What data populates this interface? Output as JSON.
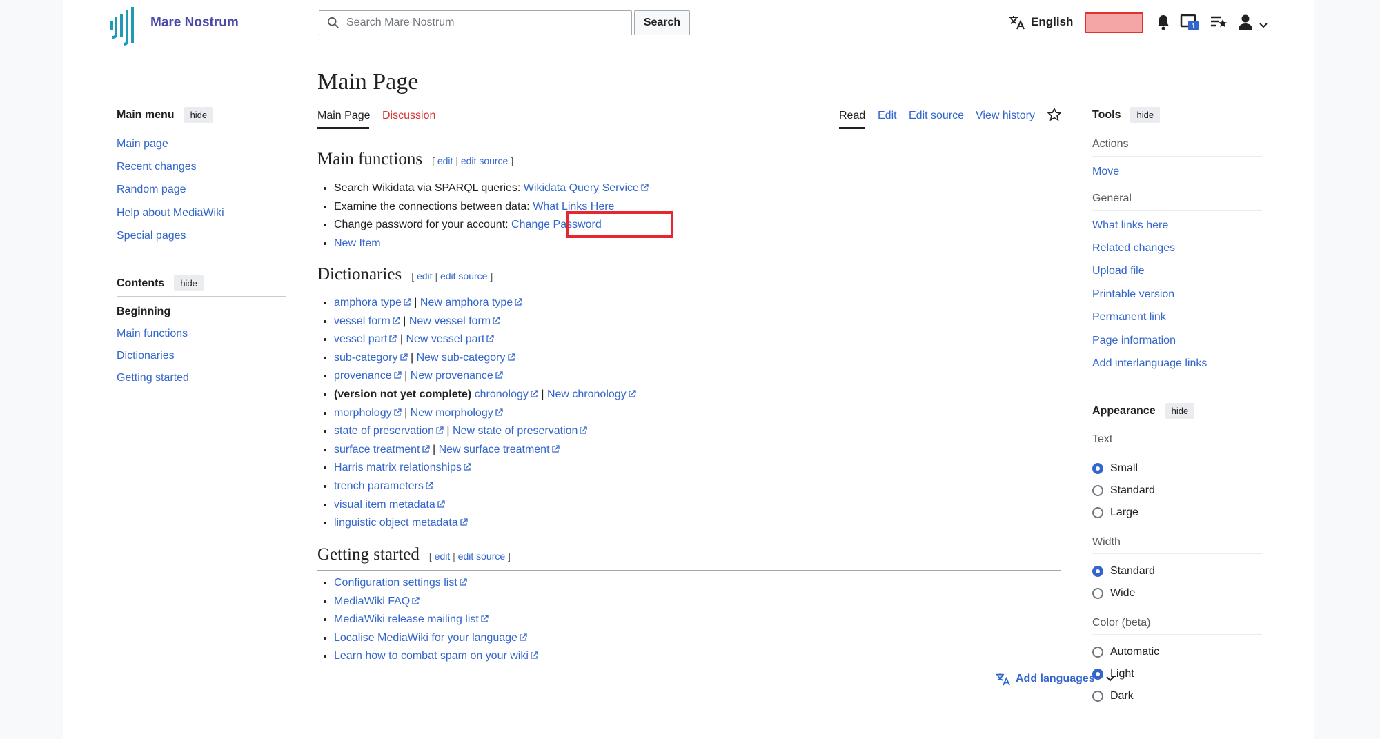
{
  "header": {
    "site_name": "Mare Nostrum",
    "search_placeholder": "Search Mare Nostrum",
    "search_button": "Search",
    "language": "English"
  },
  "main_menu": {
    "title": "Main menu",
    "hide": "hide",
    "items": [
      "Main page",
      "Recent changes",
      "Random page",
      "Help about MediaWiki",
      "Special pages"
    ]
  },
  "contents": {
    "title": "Contents",
    "hide": "hide",
    "items": [
      "Beginning",
      "Main functions",
      "Dictionaries",
      "Getting started"
    ]
  },
  "page": {
    "title": "Main Page",
    "tabs_left": [
      "Main Page",
      "Discussion"
    ],
    "tabs_right": [
      "Read",
      "Edit",
      "Edit source",
      "View history"
    ]
  },
  "edit_links": {
    "open": "[",
    "edit": "edit",
    "sep": "|",
    "edit_source": "edit source",
    "close": "]"
  },
  "main_functions": {
    "heading": "Main functions",
    "items": [
      {
        "text": "Search Wikidata via SPARQL queries: ",
        "link": "Wikidata Query Service"
      },
      {
        "text": "Examine the connections between data: ",
        "link": "What Links Here"
      },
      {
        "text": "Change password for your account: ",
        "link": "Change Password"
      },
      {
        "text": "",
        "link": "New Item"
      }
    ]
  },
  "dictionaries": {
    "heading": "Dictionaries",
    "items": [
      {
        "a": "amphora type",
        "b": "New amphora type"
      },
      {
        "a": "vessel form",
        "b": "New vessel form"
      },
      {
        "a": "vessel part",
        "b": "New vessel part"
      },
      {
        "a": "sub-category",
        "b": "New sub-category"
      },
      {
        "a": "provenance",
        "b": "New provenance"
      },
      {
        "prefix": "(version not yet complete)",
        "a": "chronology",
        "b": "New chronology"
      },
      {
        "a": "morphology",
        "b": "New morphology"
      },
      {
        "a": "state of preservation",
        "b": "New state of preservation"
      },
      {
        "a": "surface treatment",
        "b": "New surface treatment"
      },
      {
        "a": "Harris matrix relationships"
      },
      {
        "a": "trench parameters"
      },
      {
        "a": "visual item metadata"
      },
      {
        "a": "linguistic object metadata"
      }
    ]
  },
  "getting_started": {
    "heading": "Getting started",
    "items": [
      "Configuration settings list",
      "MediaWiki FAQ",
      "MediaWiki release mailing list",
      "Localise MediaWiki for your language",
      "Learn how to combat spam on your wiki"
    ]
  },
  "add_languages": "Add languages",
  "tools": {
    "title": "Tools",
    "hide": "hide",
    "actions_label": "Actions",
    "actions": [
      "Move"
    ],
    "general_label": "General",
    "general": [
      "What links here",
      "Related changes",
      "Upload file",
      "Printable version",
      "Permanent link",
      "Page information",
      "Add interlanguage links"
    ]
  },
  "appearance": {
    "title": "Appearance",
    "hide": "hide",
    "text_label": "Text",
    "text_options": [
      "Small",
      "Standard",
      "Large"
    ],
    "text_selected": "Small",
    "width_label": "Width",
    "width_options": [
      "Standard",
      "Wide"
    ],
    "width_selected": "Standard",
    "color_label": "Color (beta)",
    "color_options": [
      "Automatic",
      "Light",
      "Dark"
    ],
    "color_selected": "Light"
  },
  "notification_count": "1",
  "colors": {
    "link": "#3366cc",
    "new_link": "#d73333",
    "highlight": "#e8262f"
  },
  "icons": [
    "logo-icon",
    "search-icon",
    "translate-icon",
    "bell-icon",
    "watchlist-icon",
    "contributions-icon",
    "user-icon",
    "chevron-down-icon",
    "star-icon",
    "external-link-icon"
  ]
}
